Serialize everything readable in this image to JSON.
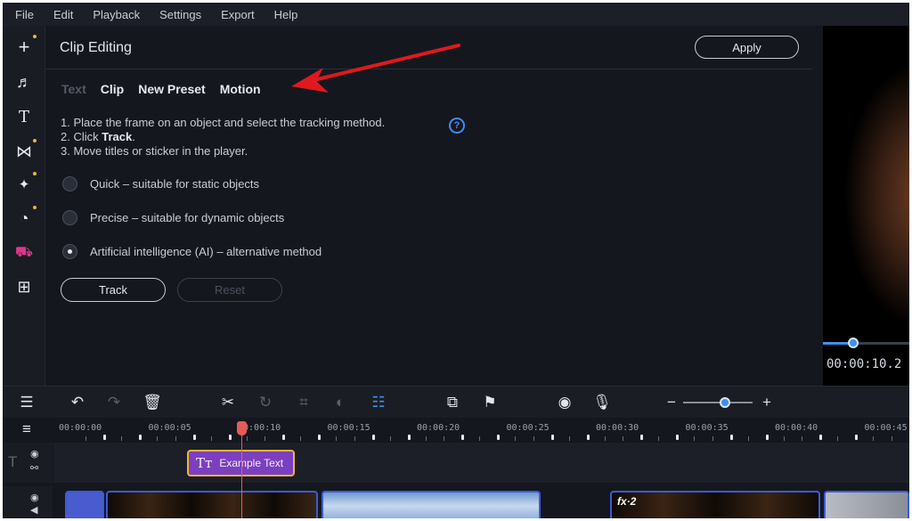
{
  "menu": [
    "File",
    "Edit",
    "Playback",
    "Settings",
    "Export",
    "Help"
  ],
  "sidebar": {
    "tools": [
      {
        "name": "add-media-icon",
        "glyph": "+",
        "dot": true
      },
      {
        "name": "music-icon",
        "glyph": "♬",
        "dot": false
      },
      {
        "name": "titles-icon",
        "glyph": "T",
        "dot": false
      },
      {
        "name": "transitions-icon",
        "glyph": "⋈",
        "dot": true
      },
      {
        "name": "effects-icon",
        "glyph": "✦",
        "dot": true
      },
      {
        "name": "filters-icon",
        "glyph": "◔",
        "dot": true
      },
      {
        "name": "stickers-icon",
        "glyph": "⛟",
        "dot": false,
        "accent": "#e0358f"
      },
      {
        "name": "more-tools-icon",
        "glyph": "⊞",
        "dot": false
      }
    ]
  },
  "panel": {
    "title": "Clip Editing",
    "apply_label": "Apply",
    "tabs": [
      {
        "label": "Text",
        "disabled": true
      },
      {
        "label": "Clip",
        "disabled": false
      },
      {
        "label": "New Preset",
        "disabled": false
      },
      {
        "label": "Motion",
        "disabled": false,
        "active": true
      }
    ],
    "instructions": {
      "line1": "1. Place the frame on an object and select the tracking method.",
      "line2_prefix": "2. Click ",
      "line2_bold": "Track",
      "line2_suffix": ".",
      "line3": "3. Move titles or sticker in the player."
    },
    "help_glyph": "?",
    "options": [
      {
        "label": "Quick – suitable for static objects",
        "checked": false
      },
      {
        "label": "Precise – suitable for dynamic objects",
        "checked": false
      },
      {
        "label": "Artificial intelligence (AI) – alternative method",
        "checked": true
      }
    ],
    "track_label": "Track",
    "reset_label": "Reset"
  },
  "preview": {
    "timecode": "00:00:10.2",
    "progress": 0.35
  },
  "timeline": {
    "ruler": [
      "00:00:00",
      "00:00:05",
      "00:00:10",
      "00:00:15",
      "00:00:20",
      "00:00:25",
      "00:00:30",
      "00:00:35",
      "00:00:40",
      "00:00:45"
    ],
    "title_clip": "Example Text",
    "fx_badge": "fx·2",
    "zoom_level": 0.6
  },
  "colors": {
    "accent_blue": "#3d8ff0",
    "playhead": "#e85a5a",
    "title_clip": "#7b3fc0",
    "highlight_arrow": "#e0191e"
  }
}
